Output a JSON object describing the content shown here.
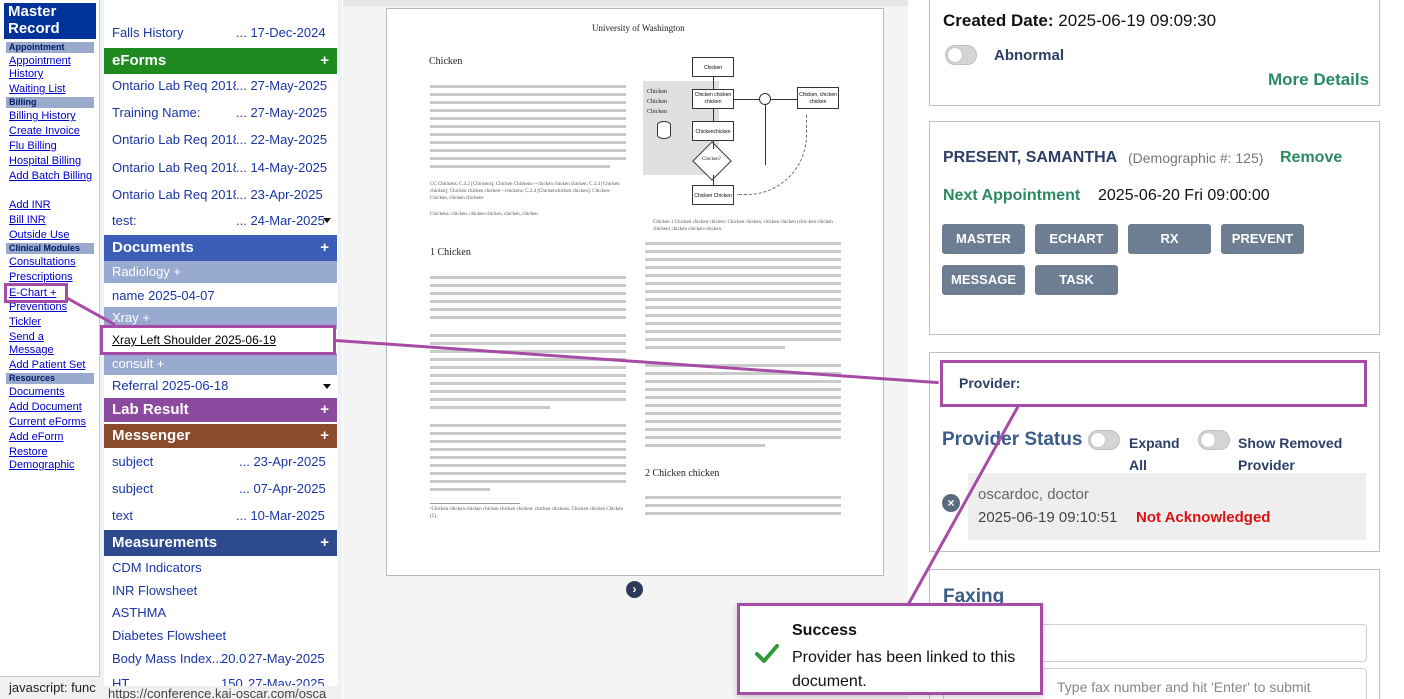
{
  "leftnav": {
    "title": "Master Record",
    "sections": {
      "appointment": "Appointment",
      "billing": "Billing",
      "clinical": "Clinical Modules",
      "resources": "Resources"
    },
    "links": {
      "appointment_history": "Appointment History",
      "waiting_list": "Waiting List",
      "billing_history": "Billing History",
      "create_invoice": "Create Invoice",
      "flu_billing": "Flu Billing",
      "hospital_billing": "Hospital Billing",
      "add_batch_billing": "Add Batch Billing",
      "add_inr": "Add INR",
      "bill_inr": "Bill INR",
      "outside_use": "Outside Use",
      "consultations": "Consultations",
      "prescriptions": "Prescriptions",
      "echart": "E-Chart +",
      "preventions": "Preventions",
      "tickler": "Tickler",
      "send_message": "Send a Message",
      "add_patient_set": "Add Patient Set",
      "documents": "Documents",
      "add_document": "Add Document",
      "current_eforms": "Current eForms",
      "add_eform": "Add eForm",
      "restore_demographic": "Restore Demographic"
    },
    "status_text": "javascript: func"
  },
  "midcol": {
    "falls": {
      "name": "Falls History",
      "date": "... 17-Dec-2024"
    },
    "eforms": {
      "title": "eForms",
      "items": [
        {
          "name": "Ontario Lab Req 2018",
          "date": "... 27-May-2025"
        },
        {
          "name": "Training Name:",
          "date": "... 27-May-2025"
        },
        {
          "name": "Ontario Lab Req 2018",
          "date": "... 22-May-2025"
        },
        {
          "name": "Ontario Lab Req 2018",
          "date": "... 14-May-2025"
        },
        {
          "name": "Ontario Lab Req 2018:",
          "date": "... 23-Apr-2025"
        },
        {
          "name": "test:",
          "date": "... 24-Mar-2025"
        }
      ]
    },
    "documents": {
      "title": "Documents",
      "radiology": "Radiology +",
      "radiology_item": "name 2025-04-07",
      "xray": "Xray +",
      "xray_item": "Xray Left Shoulder 2025-06-19",
      "consult": "consult +",
      "consult_item": "Referral 2025-06-18"
    },
    "lab": {
      "title": "Lab Result"
    },
    "messenger": {
      "title": "Messenger",
      "items": [
        {
          "name": "subject",
          "date": "... 23-Apr-2025"
        },
        {
          "name": "subject",
          "date": "... 07-Apr-2025"
        },
        {
          "name": "text",
          "date": "... 10-Mar-2025"
        }
      ]
    },
    "measurements": {
      "title": "Measurements",
      "items": [
        "CDM Indicators",
        "INR Flowsheet",
        "ASTHMA",
        "Diabetes Flowsheet"
      ],
      "bmi": {
        "name": "Body Mass Index...",
        "value": "20.0",
        "date": "27-May-2025"
      },
      "ht": {
        "name": "HT",
        "value": "150",
        "date": "27-May-2025"
      }
    },
    "plus": "+",
    "url_text": "https://conference.kai-oscar.com/osca"
  },
  "viewer": {
    "university": "University of Washington",
    "heading1": "Chicken",
    "section1": "1   Chicken",
    "section2": "2   Chicken chicken",
    "caption": "Chicken 1  Chicken chicken chicken: Chicken chicken, chicken chicken (chic-ken chicken chicken) chicken chicken-chicken.",
    "side_labels": [
      "Chicken",
      "Chicken",
      "Chicken"
    ],
    "diagram_labels": [
      "Chicken",
      "Chicken chicken chicken",
      "Chickenchicken",
      "Chicken?",
      "Chicken Chicken",
      "Chicken, chicken chicken"
    ],
    "footnote": "¹Chicken chicken chicken chicken chicken chicken: chicken chickens. Chicken chicken Chicken [5].",
    "cc_line": "CC Chickens: C.3.2 [Chickens]; Chicken Chickens—chicken chicken chicken; C.3.4 [Chicken chicken]; Chicken chicken chicken—chickens; C.2.4 [Chickenchicken chicken]: Chicken-Chicken, chicken chickens",
    "chicken_line": "Chickens: chicken, chicken chicken, chicken, chicken"
  },
  "right": {
    "created_label": "Created Date:",
    "created_value": "2025-06-19 09:09:30",
    "abnormal_label": "Abnormal",
    "more_details": "More Details",
    "patient_name": "PRESENT, SAMANTHA",
    "demographic": "(Demographic #: 125)",
    "remove": "Remove",
    "next_appt_label": "Next Appointment",
    "next_appt_value": "2025-06-20 Fri 09:00:00",
    "buttons": [
      "MASTER",
      "ECHART",
      "RX",
      "PREVENT",
      "MESSAGE",
      "TASK"
    ],
    "provider_label": "Provider:",
    "provider_status": "Provider Status",
    "expand_all": "Expand All",
    "show_removed": "Show Removed Provider",
    "provider_name": "oscardoc, doctor",
    "provider_time": "2025-06-19 09:10:51",
    "not_ack": "Not Acknowledged",
    "faxing": "Faxing",
    "fax_placeholder": "Type fax number and hit 'Enter' to submit"
  },
  "toast": {
    "title": "Success",
    "message": "Provider has been linked to this document."
  },
  "colors": {
    "eforms": "#1f8a1f",
    "documents": "#3b5db8",
    "lab": "#8b4a9e",
    "messenger": "#8a4a2b",
    "measurements": "#2e4a8f",
    "highlight": "#a64ca6",
    "success": "#2e9b3a",
    "alert": "#dd1111"
  }
}
